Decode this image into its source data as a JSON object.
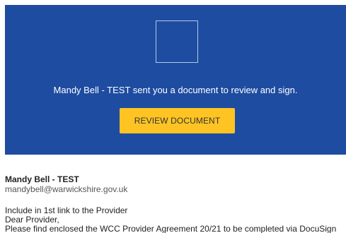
{
  "banner": {
    "message": "Mandy Bell - TEST sent you a document to review and sign.",
    "review_button_label": "REVIEW DOCUMENT",
    "background_color": "#1e4ca1",
    "button_color": "#ffc423"
  },
  "sender": {
    "name": "Mandy Bell - TEST",
    "email": "mandybell@warwickshire.gov.uk"
  },
  "message": {
    "line1": "Include in 1st link to the Provider",
    "line2": "Dear Provider,",
    "line3": "Please find enclosed the WCC Provider Agreement 20/21 to be completed via DocuSign"
  }
}
